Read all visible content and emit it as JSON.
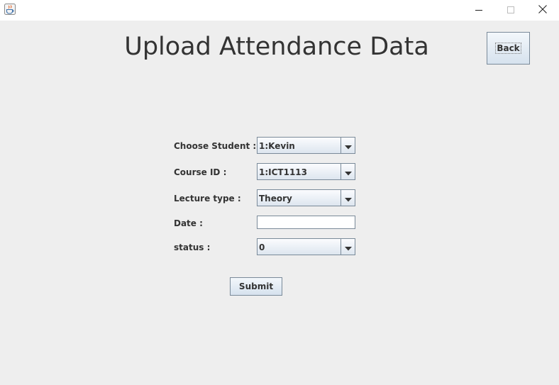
{
  "window": {
    "app_icon": "java-cup-icon",
    "controls": {
      "minimize_icon": "minimize-icon",
      "maximize_icon": "maximize-icon",
      "close_icon": "close-icon"
    }
  },
  "header": {
    "title": "Upload Attendance Data",
    "back_label": "Back"
  },
  "form": {
    "student": {
      "label": "Choose Student :",
      "value": "1:Kevin"
    },
    "course": {
      "label": "Course ID :",
      "value": "1:ICT1113"
    },
    "lecture": {
      "label": "Lecture type :",
      "value": "Theory"
    },
    "date": {
      "label": "Date :",
      "value": ""
    },
    "status": {
      "label": "status :",
      "value": "0"
    },
    "submit_label": "Submit"
  }
}
